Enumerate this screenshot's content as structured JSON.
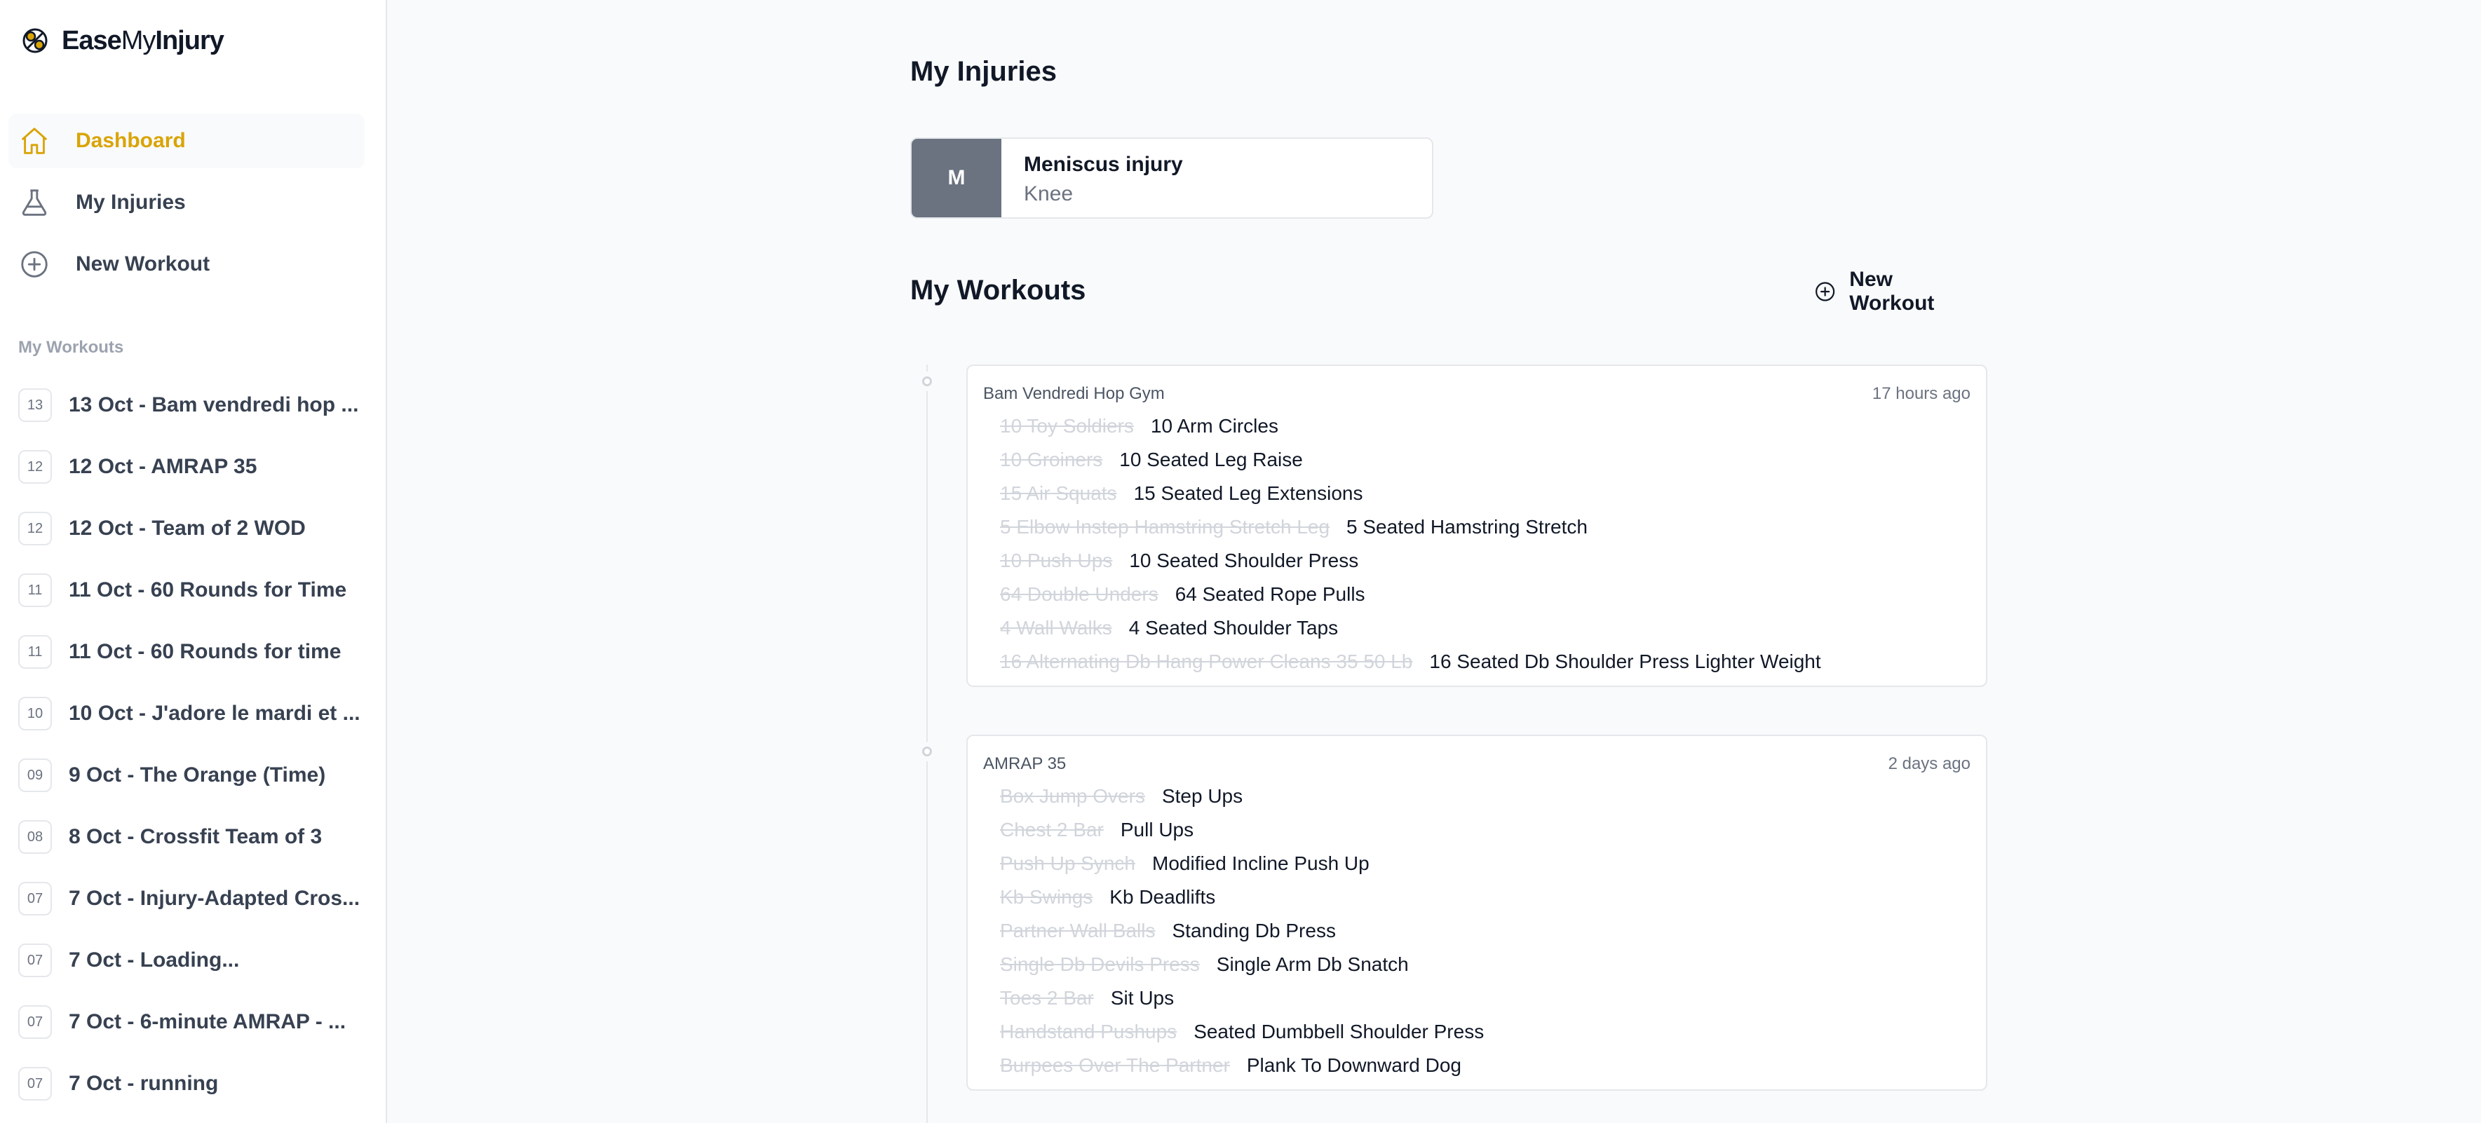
{
  "app": {
    "brand_bold": "Ease",
    "brand_regular": "My",
    "brand_bold2": "Injury",
    "accent": "#d9a406"
  },
  "nav": [
    {
      "label": "Dashboard",
      "icon": "home-icon",
      "active": true
    },
    {
      "label": "My Injuries",
      "icon": "flask-icon",
      "active": false
    },
    {
      "label": "New Workout",
      "icon": "plus-circle-icon",
      "active": false
    }
  ],
  "sidebar": {
    "section_label": "My Workouts",
    "workouts": [
      {
        "badge": "13",
        "title": "13 Oct - Bam vendredi hop ..."
      },
      {
        "badge": "12",
        "title": "12 Oct - AMRAP 35"
      },
      {
        "badge": "12",
        "title": "12 Oct - Team of 2 WOD"
      },
      {
        "badge": "11",
        "title": "11 Oct - 60 Rounds for Time"
      },
      {
        "badge": "11",
        "title": "11 Oct - 60 Rounds for time"
      },
      {
        "badge": "10",
        "title": "10 Oct - J'adore le mardi et ..."
      },
      {
        "badge": "09",
        "title": "9 Oct - The Orange (Time)"
      },
      {
        "badge": "08",
        "title": "8 Oct - Crossfit Team of 3"
      },
      {
        "badge": "07",
        "title": "7 Oct - Injury-Adapted Cros..."
      },
      {
        "badge": "07",
        "title": "7 Oct - Loading..."
      },
      {
        "badge": "07",
        "title": "7 Oct - 6-minute AMRAP - ..."
      },
      {
        "badge": "07",
        "title": "7 Oct - running"
      }
    ]
  },
  "main": {
    "injuries_title": "My Injuries",
    "injury": {
      "initial": "M",
      "name": "Meniscus injury",
      "location": "Knee"
    },
    "workouts_title": "My Workouts",
    "new_workout_label": "New Workout",
    "cards": [
      {
        "name": "Bam Vendredi Hop Gym",
        "time": "17 hours ago",
        "exercises": [
          {
            "old": "10 Toy Soldiers",
            "new": "10 Arm Circles"
          },
          {
            "old": "10 Groiners",
            "new": "10 Seated Leg Raise"
          },
          {
            "old": "15 Air Squats",
            "new": "15 Seated Leg Extensions"
          },
          {
            "old": "5 Elbow Instep Hamstring Stretch Leg",
            "new": "5 Seated Hamstring Stretch"
          },
          {
            "old": "10 Push Ups",
            "new": "10 Seated Shoulder Press"
          },
          {
            "old": "64 Double Unders",
            "new": "64 Seated Rope Pulls"
          },
          {
            "old": "4 Wall Walks",
            "new": "4 Seated Shoulder Taps"
          },
          {
            "old": "16 Alternating Db Hang Power Cleans 35 50 Lb",
            "new": "16 Seated Db Shoulder Press Lighter Weight"
          }
        ]
      },
      {
        "name": "AMRAP 35",
        "time": "2 days ago",
        "exercises": [
          {
            "old": "Box Jump Overs",
            "new": "Step Ups"
          },
          {
            "old": "Chest 2 Bar",
            "new": "Pull Ups"
          },
          {
            "old": "Push Up Synch",
            "new": "Modified Incline Push Up"
          },
          {
            "old": "Kb Swings",
            "new": "Kb Deadlifts"
          },
          {
            "old": "Partner Wall Balls",
            "new": "Standing Db Press"
          },
          {
            "old": "Single Db Devils Press",
            "new": "Single Arm Db Snatch"
          },
          {
            "old": "Toes 2 Bar",
            "new": "Sit Ups"
          },
          {
            "old": "Handstand Pushups",
            "new": "Seated Dumbbell Shoulder Press"
          },
          {
            "old": "Burpees Over The Partner",
            "new": "Plank To Downward Dog"
          }
        ]
      }
    ]
  }
}
